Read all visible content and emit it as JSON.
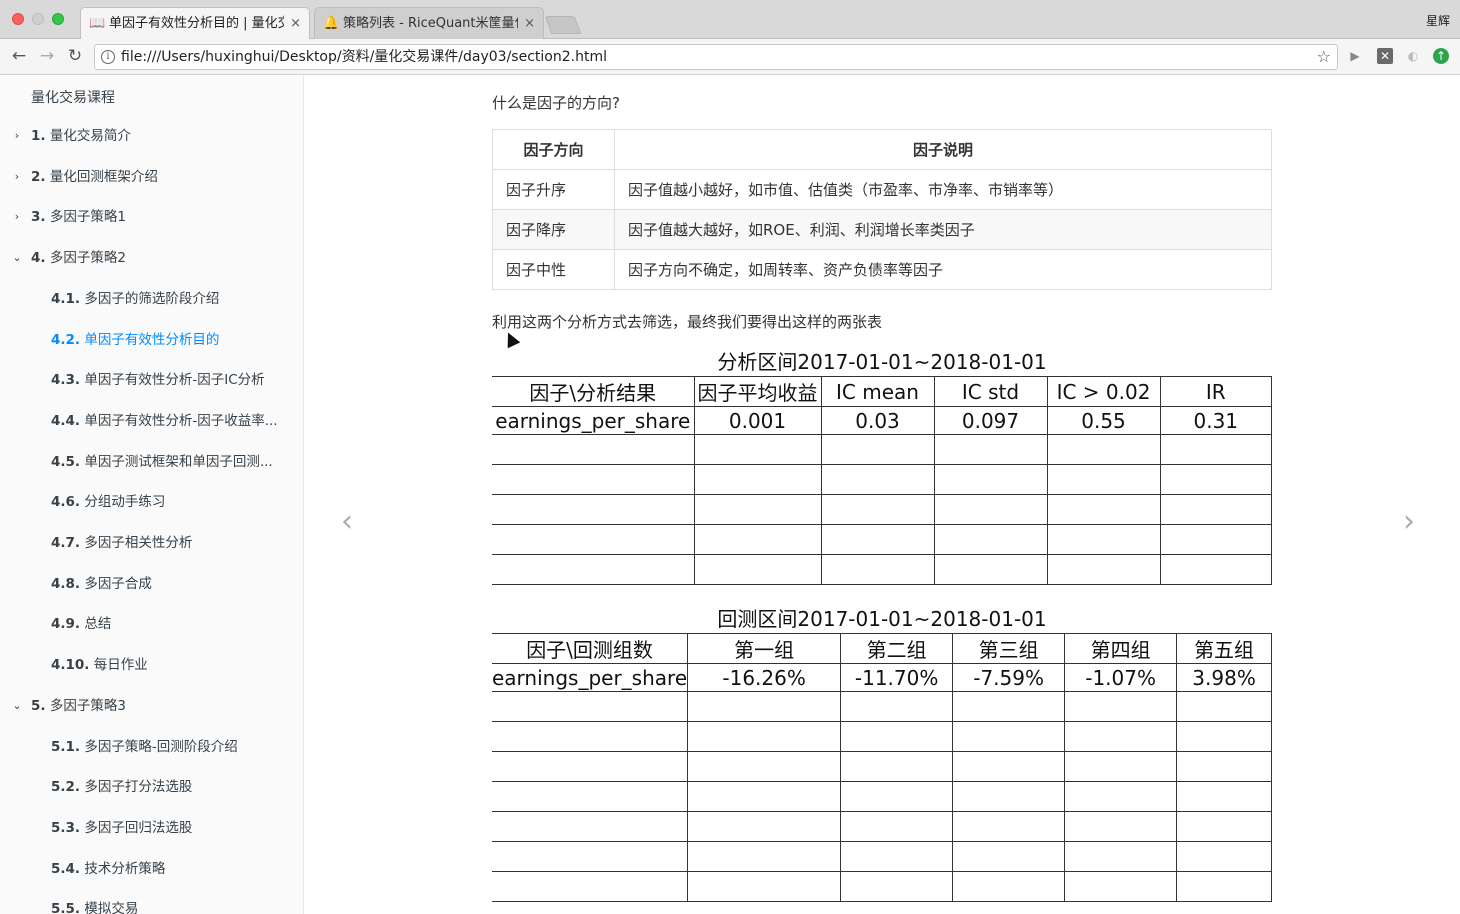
{
  "browser": {
    "tabs": [
      {
        "title": "单因子有效性分析目的 | 量化交",
        "icon": "book-icon",
        "active": true
      },
      {
        "title": "策略列表 - RiceQuant米筐量化",
        "icon": "bell-icon",
        "active": false
      }
    ],
    "close_glyph": "×",
    "user_name": "星辉",
    "url": "file:///Users/huxinghui/Desktop/资料/量化交易课件/day03/section2.html"
  },
  "sidebar": {
    "header": "量化交易课程",
    "items": [
      {
        "num": "1.",
        "label": "量化交易简介",
        "level": 1,
        "chevron": "›"
      },
      {
        "num": "2.",
        "label": "量化回测框架介绍",
        "level": 1,
        "chevron": "›"
      },
      {
        "num": "3.",
        "label": "多因子策略1",
        "level": 1,
        "chevron": "›"
      },
      {
        "num": "4.",
        "label": "多因子策略2",
        "level": 1,
        "chevron": "⌄"
      },
      {
        "num": "4.1.",
        "label": "多因子的筛选阶段介绍",
        "level": 2
      },
      {
        "num": "4.2.",
        "label": "单因子有效性分析目的",
        "level": 2,
        "active": true
      },
      {
        "num": "4.3.",
        "label": "单因子有效性分析-因子IC分析",
        "level": 2
      },
      {
        "num": "4.4.",
        "label": "单因子有效性分析-因子收益率...",
        "level": 2
      },
      {
        "num": "4.5.",
        "label": "单因子测试框架和单因子回测...",
        "level": 2
      },
      {
        "num": "4.6.",
        "label": "分组动手练习",
        "level": 2
      },
      {
        "num": "4.7.",
        "label": "多因子相关性分析",
        "level": 2
      },
      {
        "num": "4.8.",
        "label": "多因子合成",
        "level": 2
      },
      {
        "num": "4.9.",
        "label": "总结",
        "level": 2
      },
      {
        "num": "4.10.",
        "label": "每日作业",
        "level": 2
      },
      {
        "num": "5.",
        "label": "多因子策略3",
        "level": 1,
        "chevron": "⌄"
      },
      {
        "num": "5.1.",
        "label": "多因子策略-回测阶段介绍",
        "level": 2
      },
      {
        "num": "5.2.",
        "label": "多因子打分法选股",
        "level": 2
      },
      {
        "num": "5.3.",
        "label": "多因子回归法选股",
        "level": 2
      },
      {
        "num": "5.4.",
        "label": "技术分析策略",
        "level": 2
      },
      {
        "num": "5.5.",
        "label": "模拟交易",
        "level": 2
      }
    ]
  },
  "content": {
    "question": "什么是因子的方向?",
    "direction_table": {
      "headers": [
        "因子方向",
        "因子说明"
      ],
      "rows": [
        [
          "因子升序",
          "因子值越小越好，如市值、估值类（市盈率、市净率、市销率等）"
        ],
        [
          "因子降序",
          "因子值越大越好，如ROE、利润、利润增长率类因子"
        ],
        [
          "因子中性",
          "因子方向不确定，如周转率、资产负债率等因子"
        ]
      ]
    },
    "intro": "利用这两个分析方式去筛选，最终我们要得出这样的两张表",
    "analysis_table": {
      "title": "分析区间2017-01-01~2018-01-01",
      "headers": [
        "因子\\分析结果",
        "因子平均收益",
        "IC mean",
        "IC std",
        "IC  > 0.02",
        "IR"
      ],
      "rows": [
        [
          "earnings_per_share",
          "0.001",
          "0.03",
          "0.097",
          "0.55",
          "0.31"
        ]
      ],
      "blank_rows": 5
    },
    "backtest_table": {
      "title": "回测区间2017-01-01~2018-01-01",
      "headers": [
        "因子\\回测组数",
        "第一组",
        "第二组",
        "第三组",
        "第四组",
        "第五组"
      ],
      "rows": [
        [
          "earnings_per_share",
          "-16.26%",
          "-11.70%",
          "-7.59%",
          "-1.07%",
          "3.98%"
        ]
      ],
      "blank_rows": 7
    },
    "prev_arrow": "‹",
    "next_arrow": "›"
  }
}
